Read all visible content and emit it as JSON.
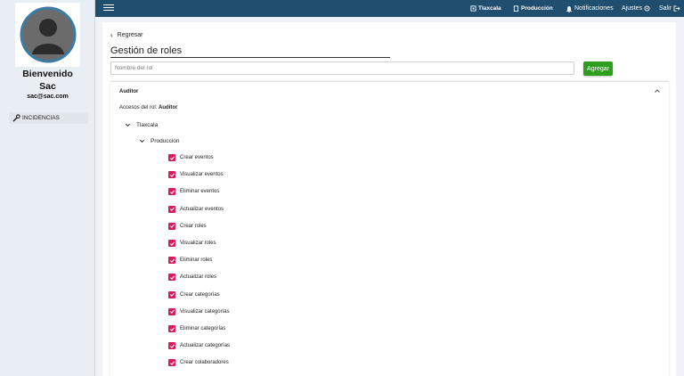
{
  "sidebar": {
    "welcome": "Bienvenido",
    "user_name": "Sac",
    "email": "sac@sac.com",
    "items": [
      {
        "label": "INCIDENCIAS",
        "icon": "wrench-icon"
      }
    ]
  },
  "topbar": {
    "nav": [
      {
        "label": "Tlaxcala",
        "icon": "building-icon"
      },
      {
        "label": "Producción",
        "icon": "clipboard-icon"
      },
      {
        "label": "Notificaciones",
        "icon": "bell-icon"
      },
      {
        "label": "Ajustes",
        "icon": "gear-icon"
      },
      {
        "label": "Salir",
        "icon": "logout-icon"
      }
    ],
    "color": "#1f4e6e"
  },
  "main": {
    "back_label": "Regresar",
    "title": "Gestión de roles",
    "role_input_placeholder": "Nombre del rol",
    "add_button": "Agregar",
    "add_button_color": "#2e9e1e"
  },
  "panel": {
    "role_name": "Auditor",
    "access_prefix": "Accesos del rol:",
    "access_role": "Auditor",
    "tree_level1": "Tlaxcala",
    "tree_level2": "Producción",
    "checkbox_color": "#d81b60",
    "permissions": [
      {
        "label": "Crear eventos",
        "checked": true
      },
      {
        "label": "Visualizar eventos",
        "checked": true
      },
      {
        "label": "Eliminar eventos",
        "checked": true
      },
      {
        "label": "Actualizar eventos",
        "checked": true
      },
      {
        "label": "Crear roles",
        "checked": true
      },
      {
        "label": "Visualizar roles",
        "checked": true
      },
      {
        "label": "Eliminar roles",
        "checked": true
      },
      {
        "label": "Actualizar roles",
        "checked": true
      },
      {
        "label": "Crear categorías",
        "checked": true
      },
      {
        "label": "Visualizar categorías",
        "checked": true
      },
      {
        "label": "Eliminar categorías",
        "checked": true
      },
      {
        "label": "Actualizar categorías",
        "checked": true
      },
      {
        "label": "Crear colaboradores",
        "checked": true
      }
    ]
  }
}
